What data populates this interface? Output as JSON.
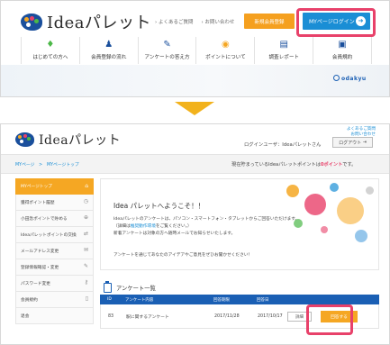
{
  "top": {
    "logo_text": "Ideaパレット",
    "links": [
      "よくあるご質問",
      "お問い合わせ"
    ],
    "register_label": "新規会員登録",
    "login_label": "MYページログイン",
    "login_arrow": "➜",
    "nav": [
      {
        "icon": "beginner-icon",
        "glyph": "♦",
        "label": "はじめての方へ"
      },
      {
        "icon": "user-icon",
        "glyph": "♟",
        "label": "会員登録の流れ"
      },
      {
        "icon": "pencil-icon",
        "glyph": "✎",
        "label": "アンケートの答え方"
      },
      {
        "icon": "coin-icon",
        "glyph": "◉",
        "label": "ポイントについて"
      },
      {
        "icon": "report-icon",
        "glyph": "▤",
        "label": "調査レポート"
      },
      {
        "icon": "terms-icon",
        "glyph": "▣",
        "label": "会員規約"
      }
    ],
    "odakyu_label": "odakyu"
  },
  "bottom": {
    "logo_text": "Ideaパレット",
    "faq_links": [
      "よくあるご質問",
      "お問い合わせ"
    ],
    "login_user": "ログインユーザ：Ideaパレットさん",
    "logout_label": "ログアウト",
    "breadcrumb": "MYページ　>　MYページトップ",
    "points_prefix": "現在貯まっているIdeaパレットポイントは",
    "points_value": "0ポイント",
    "points_suffix": "です。",
    "sidebar": [
      {
        "label": "MYページトップ",
        "icon": "home-icon",
        "glyph": "⌂",
        "active": true
      },
      {
        "label": "獲得ポイント履歴",
        "icon": "history-icon",
        "glyph": "◷"
      },
      {
        "label": "小田急ポイントで貯める",
        "icon": "point-icon",
        "glyph": "⊕"
      },
      {
        "label": "Ideaパレットポイントの交換",
        "icon": "exchange-icon",
        "glyph": "⇄"
      },
      {
        "label": "メールアドレス変更",
        "icon": "mail-icon",
        "glyph": "✉"
      },
      {
        "label": "登録情報確認・変更",
        "icon": "edit-icon",
        "glyph": "✎"
      },
      {
        "label": "パスワード変更",
        "icon": "key-icon",
        "glyph": "⚷"
      },
      {
        "label": "会員規約",
        "icon": "document-icon",
        "glyph": "▯"
      },
      {
        "label": "退会",
        "icon": "exit-icon",
        "glyph": ""
      }
    ],
    "welcome": "Idea パレットへようこそ！！",
    "intro_line1": "Ideaパレットのアンケートは、パソコン・スマートフォン・タブレットからご回答いただけます。",
    "intro_line2_prefix": "（詳細は",
    "intro_line2_link": "推奨動作環境",
    "intro_line2_suffix": "をご覧ください。）",
    "intro_line3": "新着アンケートは対象の方へ随時メールでお知らせいたします。",
    "intro_line4": "アンケートを通じてあなたのアイデアやご意見をぜひお聞かせください！",
    "survey_title": "アンケート一覧",
    "table": {
      "headers": [
        "ID",
        "アンケート内容",
        "回答期限",
        "回答日"
      ],
      "rows": [
        {
          "id": "83",
          "title": "駅に関するアンケート",
          "deadline": "2017/11/28",
          "answered": "2017/10/17",
          "detail_label": "詳細",
          "answer_label": "回答する"
        }
      ]
    },
    "colors": {
      "accent_orange": "#f5a723",
      "brand_blue": "#1a5fb4",
      "highlight_pink": "#e8416a"
    }
  }
}
